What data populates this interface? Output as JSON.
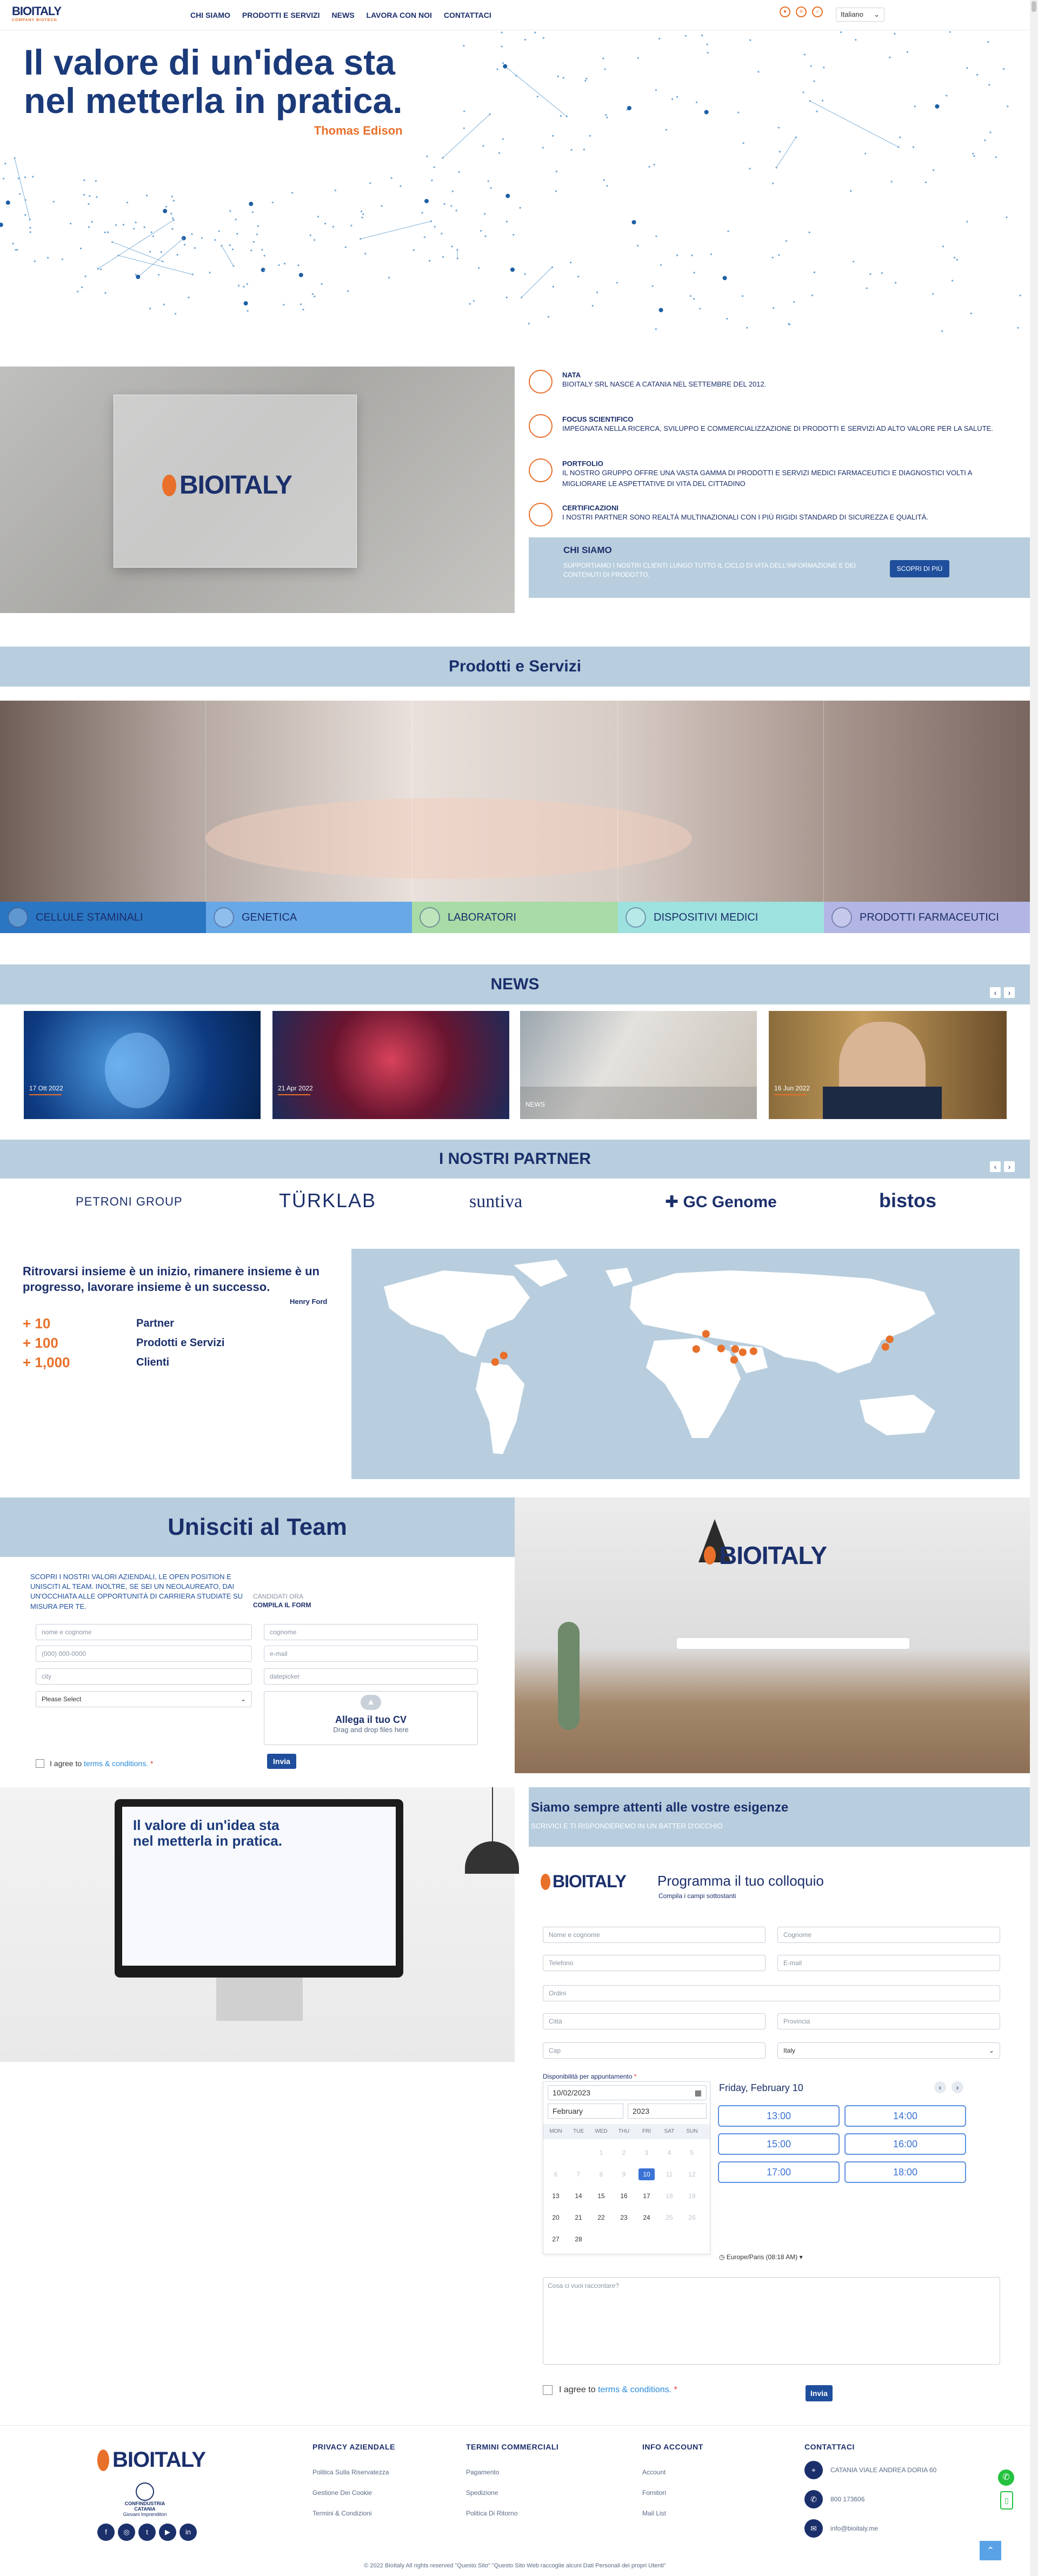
{
  "header": {
    "logo": "BIOITALY",
    "logo_sub": "COMPANY BIOTECH",
    "nav": [
      "CHI SIAMO",
      "PRODOTTI E SERVIZI",
      "NEWS",
      "LAVORA CON NOI",
      "CONTATTACI"
    ],
    "language": "Italiano"
  },
  "hero": {
    "title_line1": "Il valore di un'idea sta",
    "title_line2": "nel metterla in pratica.",
    "author": "Thomas Edison"
  },
  "about": {
    "items": [
      {
        "title": "NATA",
        "text": "BIOITALY SRL NASCE A CATANIA NEL SETTEMBRE DEL 2012."
      },
      {
        "title": "FOCUS SCIENTIFICO",
        "text": "IMPEGNATA NELLA RICERCA, SVILUPPO E COMMERCIALIZZAZIONE DI PRODOTTI E SERVIZI AD ALTO VALORE PER LA SALUTE."
      },
      {
        "title": "PORTFOLIO",
        "text": "IL NOSTRO GRUPPO OFFRE UNA VASTA GAMMA DI PRODOTTI E SERVIZI MEDICI FARMACEUTICI E DIAGNOSTICI VOLTI A MIGLIORARE LE ASPETTATIVE DI VITA DEL CITTADINO"
      },
      {
        "title": "CERTIFICAZIONI",
        "text": "I NOSTRI PARTNER SONO REALTÀ MULTINAZIONALI CON I PIÙ RIGIDI STANDARD DI SICUREZZA E QUALITÀ."
      }
    ],
    "chi_siamo_title": "CHI SIAMO",
    "chi_siamo_text": "SUPPORTIAMO I NOSTRI CLIENTI LUNGO TUTTO IL CICLO DI VITA DELL'INFORMAZIONE E DEI CONTENUTI DI PRODOTTO.",
    "scopri": "SCOPRI DI PIÙ"
  },
  "prodotti": {
    "title": "Prodotti e Servizi",
    "categories": [
      "CELLULE STAMINALI",
      "GENETICA",
      "LABORATORI",
      "DISPOSITIVI MEDICI",
      "PRODOTTI FARMACEUTICI"
    ]
  },
  "news": {
    "title": "NEWS",
    "cards": [
      {
        "date": "17 Ott 2022"
      },
      {
        "date": "21 Apr 2022"
      },
      {
        "date": "NEWS"
      },
      {
        "date": "16 Jun 2022"
      }
    ]
  },
  "partners": {
    "title": "I NOSTRI PARTNER",
    "logos": [
      "PETRONI GROUP",
      "TÜRKLAB",
      "suntiva",
      "GC Genome",
      "bistos"
    ]
  },
  "team_quote": {
    "text": "Ritrovarsi insieme è un inizio, rimanere insieme è un progresso, lavorare insieme è un successo.",
    "author": "Henry Ford"
  },
  "stats": [
    {
      "n": "10",
      "label": "Partner"
    },
    {
      "n": "100",
      "label": "Prodotti e Servizi"
    },
    {
      "n": "1,000",
      "label": "Clienti"
    }
  ],
  "join": {
    "title": "Unisciti al Team",
    "text": "SCOPRI I NOSTRI VALORI AZIENDALI, LE OPEN POSITION E UNISCITI AL TEAM. INOLTRE, SE SEI UN NEOLAUREATO, DAI UN'OCCHIATA ALLE OPPORTUNITÀ DI CARRIERA STUDIATE SU MISURA PER TE.",
    "cand1": "CANDIDATI ORA",
    "cand2": "COMPILA IL FORM",
    "ph_name": "nome e cognome",
    "ph_surname": "cognome",
    "ph_phone": "(000) 000-0000",
    "ph_email": "e-mail",
    "ph_city": "city",
    "ph_date": "datepicker",
    "select": "Please Select",
    "upload_title": "Allega il tuo CV",
    "upload_sub": "Drag and drop files here",
    "agree": "I agree to",
    "terms": "terms & conditions.",
    "send": "Invia"
  },
  "contact": {
    "title": "Siamo sempre attenti alle vostre esigenze",
    "sub": "SCRIVICI E TI RISPONDEREMO IN UN BATTER D'OCCHIO",
    "form_title": "Programma il tuo colloquio",
    "form_sub": "Compila i campi sottostanti",
    "fields": [
      "Nome e cognome",
      "Cognome",
      "Telefono",
      "E-mail",
      "Ordini",
      "Città",
      "Provincia",
      "Cap",
      "Italy"
    ],
    "dispo": "Disponibilità per appuntamento",
    "date_val": "10/02/2023",
    "month": "February",
    "year": "2023",
    "weekdays": [
      "MON",
      "TUE",
      "WED",
      "THU",
      "FRI",
      "SAT",
      "SUN"
    ],
    "day_title": "Friday, February 10",
    "slots": [
      "13:00",
      "14:00",
      "15:00",
      "16:00",
      "17:00",
      "18:00"
    ],
    "tz": "Europe/Paris (08:18 AM)",
    "textarea": "Cosa ci vuoi raccontare?",
    "agree": "I agree to",
    "terms": "terms & conditions.",
    "send": "Invia"
  },
  "footer": {
    "logo": "BIOITALY",
    "confindustria": "CONFINDUSTRIA CATANIA",
    "confindustria_sub": "Giovani Imprenditori",
    "cols": [
      {
        "title": "PRIVACY AZIENDALE",
        "links": [
          "Politica Sulla Riservatezza",
          "Gestione Dei Cookie",
          "Termini & Condizioni"
        ]
      },
      {
        "title": "TERMINI COMMERCIALI",
        "links": [
          "Pagamento",
          "Spedizione",
          "Politica Di Ritorno"
        ]
      },
      {
        "title": "INFO ACCOUNT",
        "links": [
          "Account",
          "Fornitori",
          "Mail List"
        ]
      }
    ],
    "contacts_title": "CONTATTACI",
    "address": "CATANIA VIALE ANDREA DORIA 60",
    "phone": "800 173606",
    "email": "info@bioitaly.me",
    "copyright": "© 2022 BioItaly All rights reserved \"Questo Sito\" \"Questo Sito Web raccoglie alcuni Dati Personali dei propri Utenti\""
  }
}
